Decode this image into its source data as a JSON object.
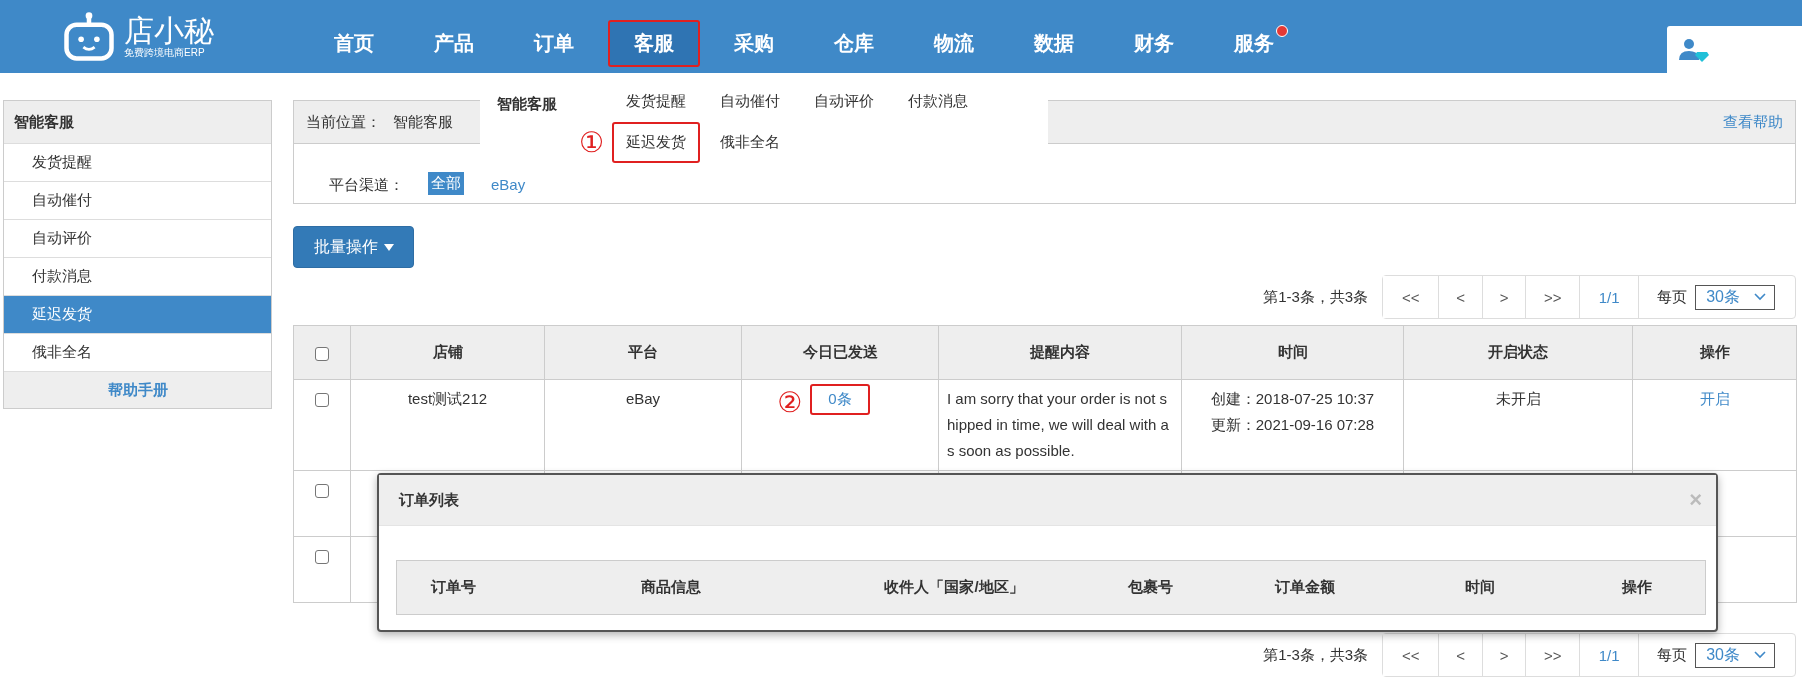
{
  "header": {
    "logo": {
      "name": "店小秘",
      "tagline": "免费跨境电商ERP"
    },
    "nav": [
      {
        "label": "首页",
        "selected": false,
        "highlighted": false,
        "badge": false
      },
      {
        "label": "产品",
        "selected": false,
        "highlighted": false,
        "badge": false
      },
      {
        "label": "订单",
        "selected": false,
        "highlighted": false,
        "badge": false
      },
      {
        "label": "客服",
        "selected": true,
        "highlighted": true,
        "badge": false
      },
      {
        "label": "采购",
        "selected": false,
        "highlighted": false,
        "badge": false
      },
      {
        "label": "仓库",
        "selected": false,
        "highlighted": false,
        "badge": false
      },
      {
        "label": "物流",
        "selected": false,
        "highlighted": false,
        "badge": false
      },
      {
        "label": "数据",
        "selected": false,
        "highlighted": false,
        "badge": false
      },
      {
        "label": "财务",
        "selected": false,
        "highlighted": false,
        "badge": false
      },
      {
        "label": "服务",
        "selected": false,
        "highlighted": false,
        "badge": true
      }
    ]
  },
  "nav_menu": {
    "title": "智能客服",
    "rows": [
      [
        {
          "label": "发货提醒",
          "highlighted": false
        },
        {
          "label": "自动催付",
          "highlighted": false
        },
        {
          "label": "自动评价",
          "highlighted": false
        },
        {
          "label": "付款消息",
          "highlighted": false
        }
      ],
      [
        {
          "label": "延迟发货",
          "highlighted": true,
          "marker": "①"
        },
        {
          "label": "俄非全名",
          "highlighted": false
        }
      ]
    ]
  },
  "sidebar": {
    "title": "智能客服",
    "items": [
      {
        "label": "发货提醒",
        "selected": false
      },
      {
        "label": "自动催付",
        "selected": false
      },
      {
        "label": "自动评价",
        "selected": false
      },
      {
        "label": "付款消息",
        "selected": false
      },
      {
        "label": "延迟发货",
        "selected": true
      },
      {
        "label": "俄非全名",
        "selected": false
      }
    ],
    "footer": "帮助手册"
  },
  "breadcrumb": {
    "label": "当前位置：",
    "path": "智能客服",
    "help": "查看帮助"
  },
  "filter": {
    "label": "平台渠道：",
    "options": [
      {
        "label": "全部",
        "selected": true
      },
      {
        "label": "eBay",
        "selected": false
      }
    ]
  },
  "batch_button": "批量操作",
  "pagination_top": {
    "summary": "第1-3条，共3条",
    "buttons": [
      "<<",
      "<",
      ">",
      ">>"
    ],
    "page": "1/1",
    "per_page_label": "每页",
    "per_page": "30条"
  },
  "table": {
    "header_checked": false,
    "columns": [
      "店铺",
      "平台",
      "今日已发送",
      "提醒内容",
      "时间",
      "开启状态",
      "操作"
    ],
    "rows": [
      {
        "checked": false,
        "store": "test测试212",
        "platform": "eBay",
        "sent_today": {
          "text": "0条",
          "highlighted": true,
          "marker": "②"
        },
        "message": "I am sorry that your order is not shipped in time, we will deal with as soon as possible.",
        "created": "创建：2018-07-25 10:37",
        "updated": "更新：2021-09-16 07:28",
        "status": "未开启",
        "action": "开启"
      },
      {
        "checked": false
      },
      {
        "checked": false
      }
    ]
  },
  "pagination_bottom": {
    "summary": "第1-3条，共3条",
    "buttons": [
      "<<",
      "<",
      ">",
      ">>"
    ],
    "page": "1/1",
    "per_page_label": "每页",
    "per_page": "30条"
  },
  "modal": {
    "title": "订单列表",
    "close": "×",
    "columns": [
      "订单号",
      "商品信息",
      "收件人「国家/地区」",
      "包裹号",
      "订单金额",
      "时间",
      "操作"
    ]
  }
}
